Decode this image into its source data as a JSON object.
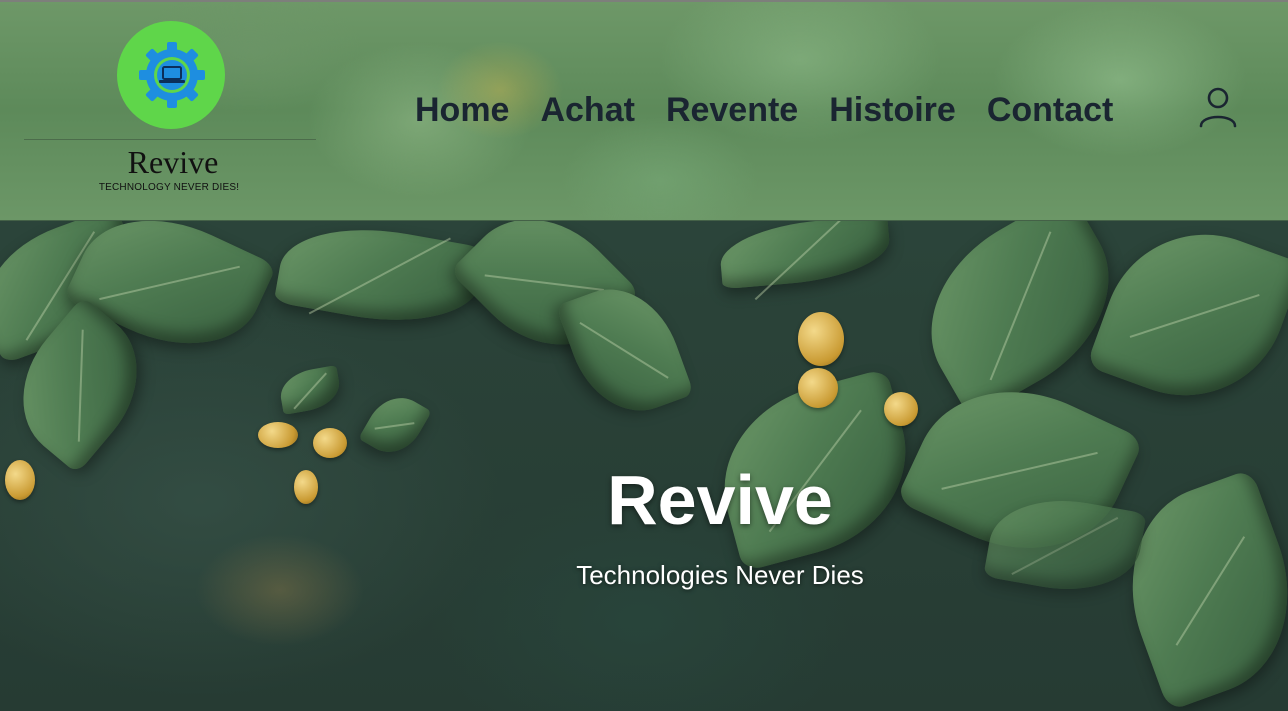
{
  "logo": {
    "icon": "gear-laptop-logo-icon",
    "name": "Revive",
    "tagline": "TECHNOLOGY NEVER DIES!",
    "circle_color": "#5fd64a",
    "gear_color": "#1e8ee0"
  },
  "nav": {
    "items": [
      {
        "label": "Home"
      },
      {
        "label": "Achat"
      },
      {
        "label": "Revente"
      },
      {
        "label": "Histoire"
      },
      {
        "label": "Contact"
      }
    ],
    "text_color": "#1a2531"
  },
  "account": {
    "icon": "user-icon"
  },
  "hero": {
    "title": "Revive",
    "subtitle": "Technologies Never Dies",
    "background": "leaf-foliage-image"
  }
}
